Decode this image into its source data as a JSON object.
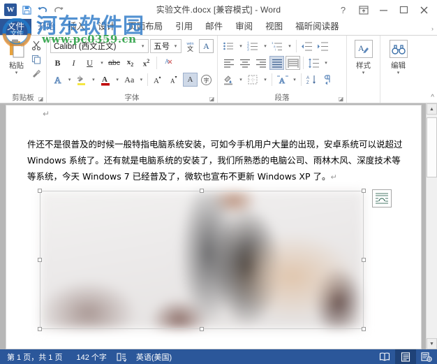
{
  "window": {
    "title": "实验文件.docx [兼容模式] - Word",
    "app_name": "Word",
    "logo_glyph": "W",
    "help_label": "?",
    "ribbon_display_label": "ribbon-display-options",
    "minimize_label": "minimize",
    "maximize_label": "maximize",
    "close_label": "close"
  },
  "quick_access": {
    "items": [
      {
        "name": "save-icon",
        "label": "保存"
      },
      {
        "name": "undo-icon",
        "label": "撤消"
      },
      {
        "name": "redo-icon",
        "label": "恢复"
      }
    ]
  },
  "tabs": [
    {
      "label": "文件",
      "type": "file",
      "active": false
    },
    {
      "label": "开始",
      "type": "normal",
      "active": true
    },
    {
      "label": "插入",
      "type": "normal",
      "active": false
    },
    {
      "label": "设计",
      "type": "normal",
      "active": false
    },
    {
      "label": "页面布局",
      "type": "normal",
      "active": false
    },
    {
      "label": "引用",
      "type": "normal",
      "active": false
    },
    {
      "label": "邮件",
      "type": "normal",
      "active": false
    },
    {
      "label": "审阅",
      "type": "normal",
      "active": false
    },
    {
      "label": "视图",
      "type": "normal",
      "active": false
    },
    {
      "label": "福昕阅读器",
      "type": "normal",
      "active": false
    }
  ],
  "tabstrip_overflow": "›",
  "ribbon": {
    "collapse_label": "^",
    "groups": {
      "clipboard": {
        "label": "剪贴板",
        "paste_label": "粘贴",
        "paste_caret": "▾",
        "small_buttons": [
          {
            "name": "cut-icon",
            "label": "剪切"
          },
          {
            "name": "copy-icon",
            "label": "复制"
          },
          {
            "name": "format-painter-icon",
            "label": "格式刷"
          }
        ],
        "launcher": "◪"
      },
      "font": {
        "label": "字体",
        "font_name": "Calibri (西文正文)",
        "font_name_placeholder": "字体",
        "font_size": "五号",
        "font_size_placeholder": "字号",
        "phonetic_label": "拼音指南",
        "enclose_label": "带圈字符",
        "buttons": [
          {
            "name": "bold-button",
            "label": "B"
          },
          {
            "name": "italic-button",
            "label": "I"
          },
          {
            "name": "underline-button",
            "label": "U"
          },
          {
            "name": "strikethrough-button",
            "label": "abc"
          },
          {
            "name": "subscript-button",
            "label": "x₂"
          },
          {
            "name": "superscript-button",
            "label": "x²"
          },
          {
            "name": "clear-formatting-button",
            "label": "清除格式"
          }
        ],
        "row3": [
          {
            "name": "text-effects-button",
            "label": "A"
          },
          {
            "name": "text-highlight-button",
            "label": "ab"
          },
          {
            "name": "font-color-button",
            "label": "A"
          },
          {
            "name": "change-case-button",
            "label": "Aa"
          },
          {
            "name": "grow-font-button",
            "label": "A"
          },
          {
            "name": "shrink-font-button",
            "label": "A"
          },
          {
            "name": "character-shading-button",
            "label": "A"
          },
          {
            "name": "enclose-characters-button",
            "label": "字"
          }
        ],
        "launcher": "◪"
      },
      "paragraph": {
        "label": "段落",
        "row1": [
          {
            "name": "bullets-button",
            "label": "项目符号"
          },
          {
            "name": "numbering-button",
            "label": "编号"
          },
          {
            "name": "multilevel-list-button",
            "label": "多级列表"
          },
          {
            "name": "decrease-indent-button",
            "label": "减少缩进量"
          },
          {
            "name": "increase-indent-button",
            "label": "增加缩进量"
          }
        ],
        "row2": [
          {
            "name": "align-left-button",
            "label": "左对齐"
          },
          {
            "name": "align-center-button",
            "label": "居中"
          },
          {
            "name": "align-right-button",
            "label": "右对齐"
          },
          {
            "name": "justify-button",
            "label": "两端对齐",
            "pressed": true
          },
          {
            "name": "distribute-button",
            "label": "分散对齐"
          },
          {
            "name": "line-spacing-button",
            "label": "行和段间距"
          }
        ],
        "row3": [
          {
            "name": "shading-button",
            "label": "底纹"
          },
          {
            "name": "borders-button",
            "label": "边框"
          },
          {
            "name": "text-align-button",
            "label": "文本对齐"
          },
          {
            "name": "sort-button",
            "label": "排序"
          },
          {
            "name": "show-marks-button",
            "label": "显示/隐藏编辑标记"
          }
        ],
        "launcher": "◪"
      },
      "styles": {
        "label": "样式",
        "caret": "▾",
        "icon": "styles-icon"
      },
      "editing": {
        "label": "编辑",
        "caret": "▾",
        "icon": "binoculars-icon"
      }
    }
  },
  "document": {
    "pilcrow": "↵",
    "paragraph_text": "件还不是很普及的时候一般特指电脑系统安装，可如今手机用户大量的出现，安卓系统可以说超过 Windows 系统了。还有就是电脑系统的安装了，我们所熟悉的电脑公司、雨林木风、深度技术等等系统，今天 Windows 7 已经普及了，微软也宣布不更新 Windows XP 了。",
    "paragraph_mark": "↵",
    "image": {
      "name": "inserted-picture",
      "alt": "blurred photo",
      "selected": true
    },
    "layout_options_label": "布局选项"
  },
  "scrollbar": {
    "up": "▲",
    "down": "▼"
  },
  "status_bar": {
    "page_info": "第 1 页，共 1 页",
    "word_count": "142 个字",
    "proofing_icon": "proofing-errors-icon",
    "language": "英语(美国)",
    "views": [
      {
        "name": "read-mode-view-button",
        "label": "阅读视图",
        "active": false
      },
      {
        "name": "print-layout-view-button",
        "label": "页面视图",
        "active": true
      },
      {
        "name": "web-layout-view-button",
        "label": "Web 版式视图",
        "active": false
      }
    ]
  },
  "watermark": {
    "site_name": "河东软件园",
    "url": "www.pc0359.cn",
    "logo_text": "文件"
  },
  "colors": {
    "accent": "#2b579a",
    "watermark_blue": "#2d79c7",
    "watermark_green": "#1f9c3a"
  }
}
